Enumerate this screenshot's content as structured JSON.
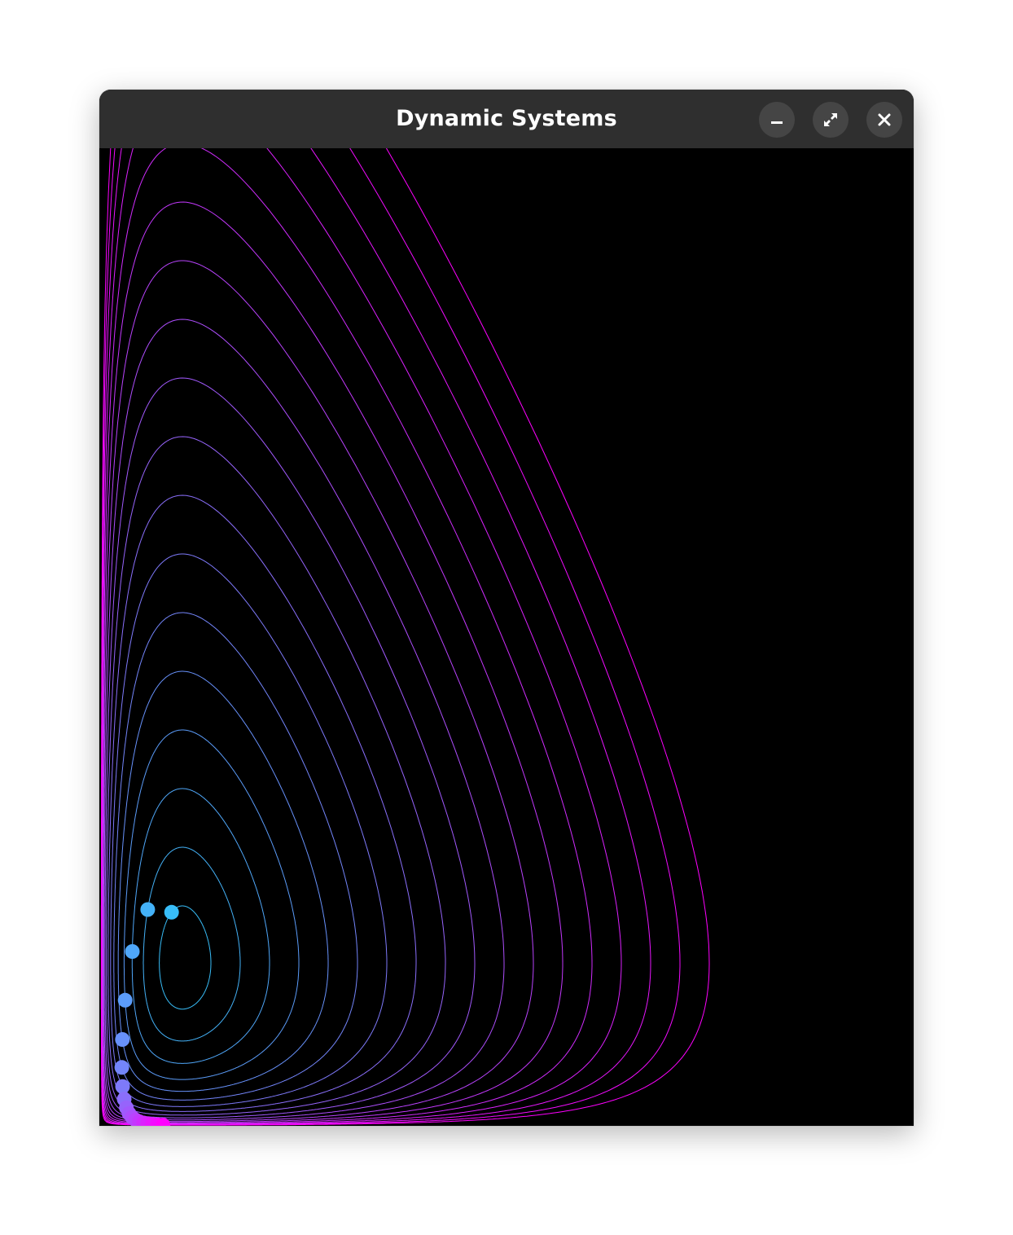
{
  "window": {
    "title": "Dynamic Systems"
  },
  "titlebar_buttons": [
    {
      "name": "minimize",
      "icon": "minimize-icon"
    },
    {
      "name": "maximize",
      "icon": "maximize-icon"
    },
    {
      "name": "close",
      "icon": "close-icon"
    }
  ],
  "plot": {
    "background": "#000000",
    "orbit_color_inner": "#38bdf8",
    "orbit_color_outer": "#ff00ff",
    "orbit_count": 18,
    "marker_count": 18
  }
}
